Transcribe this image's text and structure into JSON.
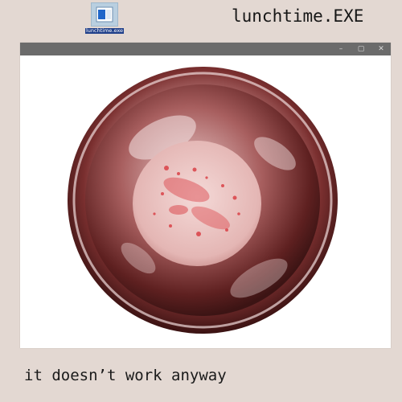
{
  "desktop": {
    "icon_label": "lunchtime.exe",
    "icon_name": "app-window-icon"
  },
  "app_title": "lunchtime.EXE",
  "window": {
    "controls": {
      "minimize": "–",
      "maximize": "▢",
      "close": "✕"
    },
    "content_image": "metal-bowl-with-food-residue"
  },
  "caption": "it doesn’t work anyway",
  "colors": {
    "desktop_background": "#e3d8d2",
    "titlebar": "#6b6b6b",
    "icon_label_background": "#1f3f8a",
    "bowl_tint": "#8a3b3b"
  }
}
